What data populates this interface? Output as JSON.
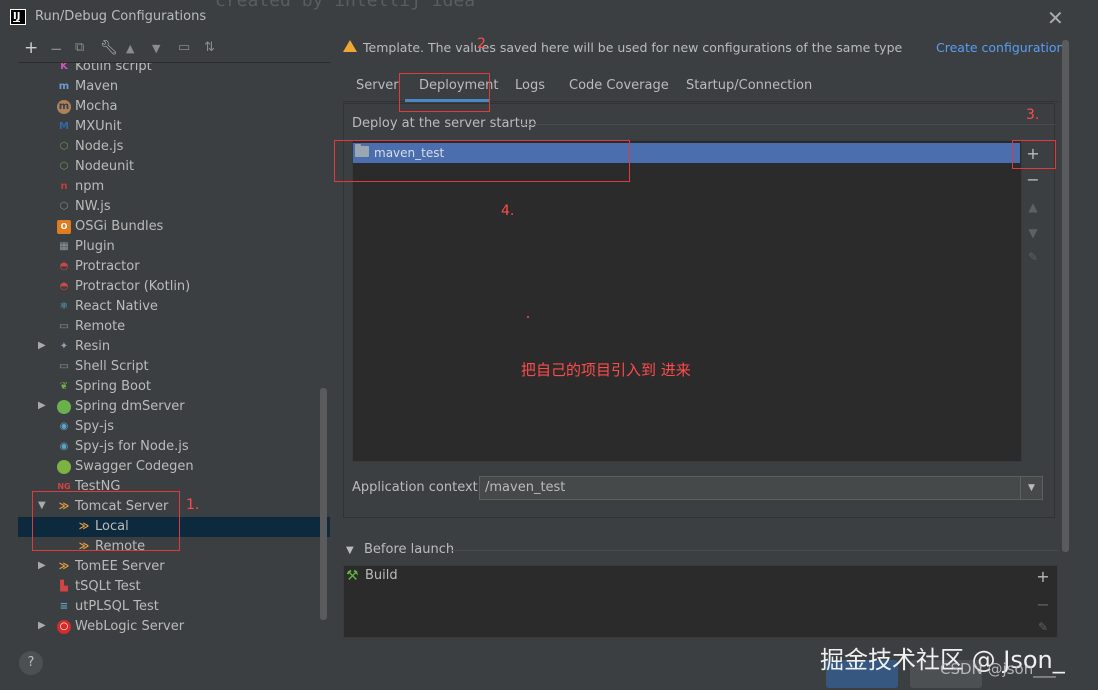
{
  "window": {
    "title": "Run/Debug Configurations",
    "background_ghost_text": "created by intellij idea"
  },
  "toolbar": {
    "icons": [
      "add-icon",
      "remove-icon",
      "copy-icon",
      "wrench-icon",
      "move-up-icon",
      "move-down-icon",
      "folder-icon",
      "sort-icon"
    ]
  },
  "tree": {
    "items": [
      {
        "label": "Kotlin script",
        "icon": "kotlin-icon",
        "color": "#c757bc"
      },
      {
        "label": "Maven",
        "icon": "maven-icon",
        "color": "#6e9bd1"
      },
      {
        "label": "Mocha",
        "icon": "mocha-icon",
        "color": "#b0805a"
      },
      {
        "label": "MXUnit",
        "icon": "mxunit-icon",
        "color": "#3466a8"
      },
      {
        "label": "Node.js",
        "icon": "nodejs-icon",
        "color": "#6d9c54"
      },
      {
        "label": "Nodeunit",
        "icon": "nodeunit-icon",
        "color": "#6d9c54"
      },
      {
        "label": "npm",
        "icon": "npm-icon",
        "color": "#c73a3a"
      },
      {
        "label": "NW.js",
        "icon": "nwjs-icon",
        "color": "#7d8a95"
      },
      {
        "label": "OSGi Bundles",
        "icon": "osgi-icon",
        "color": "#e07b20"
      },
      {
        "label": "Plugin",
        "icon": "plugin-icon",
        "color": "#8b9aa5"
      },
      {
        "label": "Protractor",
        "icon": "protractor-icon",
        "color": "#d04545"
      },
      {
        "label": "Protractor (Kotlin)",
        "icon": "protractor-icon",
        "color": "#d04545"
      },
      {
        "label": "React Native",
        "icon": "react-icon",
        "color": "#5fc6e6"
      },
      {
        "label": "Remote",
        "icon": "remote-icon",
        "color": "#8b9aa5"
      },
      {
        "label": "Resin",
        "icon": "resin-icon",
        "color": "#8ea2b8",
        "expandable": true
      },
      {
        "label": "Shell Script",
        "icon": "shell-icon",
        "color": "#8b9aa5"
      },
      {
        "label": "Spring Boot",
        "icon": "spring-boot-icon",
        "color": "#6ab04c"
      },
      {
        "label": "Spring dmServer",
        "icon": "spring-dm-icon",
        "color": "#6ab04c",
        "expandable": true
      },
      {
        "label": "Spy-js",
        "icon": "spyjs-icon",
        "color": "#5fa3c8"
      },
      {
        "label": "Spy-js for Node.js",
        "icon": "spyjs-icon",
        "color": "#5fa3c8"
      },
      {
        "label": "Swagger Codegen",
        "icon": "swagger-icon",
        "color": "#7cb342"
      },
      {
        "label": "TestNG",
        "icon": "testng-icon",
        "color": "#d04545"
      },
      {
        "label": "Tomcat Server",
        "icon": "tomcat-icon",
        "color": "#e6a23c",
        "expanded": true
      },
      {
        "label": "Local",
        "icon": "tomcat-icon",
        "color": "#e6a23c",
        "child": true,
        "selected": true
      },
      {
        "label": "Remote",
        "icon": "tomcat-icon",
        "color": "#e6a23c",
        "child": true
      },
      {
        "label": "TomEE Server",
        "icon": "tomee-icon",
        "color": "#e6a23c",
        "expandable": true
      },
      {
        "label": "tSQLt Test",
        "icon": "tsqlt-icon",
        "color": "#d04545"
      },
      {
        "label": "utPLSQL Test",
        "icon": "utplsql-icon",
        "color": "#5fa3c8"
      },
      {
        "label": "WebLogic Server",
        "icon": "weblogic-icon",
        "color": "#d62b2b",
        "expandable": true
      }
    ]
  },
  "help_label": "?",
  "notice": {
    "text": "Template. The values saved here will be used for new configurations of the same type",
    "link": "Create configuration"
  },
  "tabs": [
    {
      "label": "Server"
    },
    {
      "label": "Deployment",
      "active": true
    },
    {
      "label": "Logs"
    },
    {
      "label": "Code Coverage"
    },
    {
      "label": "Startup/Connection"
    }
  ],
  "deployment": {
    "section_title": "Deploy at the server startup",
    "items": [
      "maven_test"
    ],
    "tools": {
      "add": "+",
      "remove": "−"
    }
  },
  "app_context": {
    "label": "Application context:",
    "value": "/maven_test"
  },
  "before_launch": {
    "title": "Before launch",
    "items": [
      "Build"
    ],
    "tools": {
      "add": "+",
      "remove": "−"
    }
  },
  "annotations": {
    "n1": "1.",
    "n2": "2",
    "n3": "3.",
    "n4": "4.",
    "note": "把自己的项目引入到 进来",
    "color": "#e0393e"
  },
  "watermark": {
    "line1": "掘金技术社区 @ Json_",
    "line2": "CSDN @json___"
  }
}
